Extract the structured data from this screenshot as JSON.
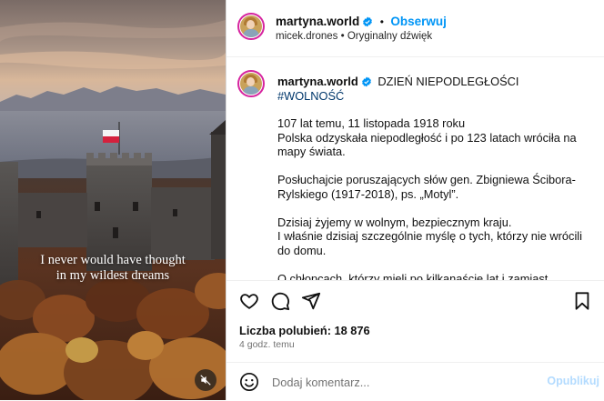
{
  "media": {
    "caption_line1": "I never would have thought",
    "caption_line2": "in my wildest dreams"
  },
  "header": {
    "username": "martyna.world",
    "separator": "•",
    "follow_label": "Obserwuj",
    "audio_author": "micek.drones",
    "audio_dot": "•",
    "audio_label": "Oryginalny dźwięk"
  },
  "post": {
    "username": "martyna.world",
    "title": "DZIEŃ NIEPODLEGŁOŚCI",
    "hashtag": "#WOLNOŚĆ",
    "paragraphs": [
      "107 lat temu, 11 listopada 1918 roku\nPolska odzyskała niepodległość i po 123 latach wróciła na mapy świata.",
      "Posłuchajcie poruszających słów gen. Zbigniewa Ścibora-Rylskiego (1917-2018), ps. „Motyl”.",
      "Dzisiaj żyjemy w wolnym, bezpiecznym kraju.\nI właśnie dzisiaj szczególnie myślę o tych, którzy nie wrócili do domu.",
      "O chłopcach, którzy mieli po kilkanaście lat i zamiast planować"
    ]
  },
  "stats": {
    "likes": "Liczba polubień: 18 876",
    "time": "4 godz. temu"
  },
  "comment": {
    "placeholder": "Dodaj komentarz...",
    "publish_label": "Opublikuj"
  },
  "colors": {
    "accent": "#0095f6",
    "verified": "#0095f6",
    "publish_disabled": "#b3dbff",
    "hashtag": "#00376b"
  },
  "icons": [
    "heart-icon",
    "comment-icon",
    "share-icon",
    "bookmark-icon",
    "emoji-icon",
    "muted-speaker-icon",
    "verified-badge-icon"
  ]
}
